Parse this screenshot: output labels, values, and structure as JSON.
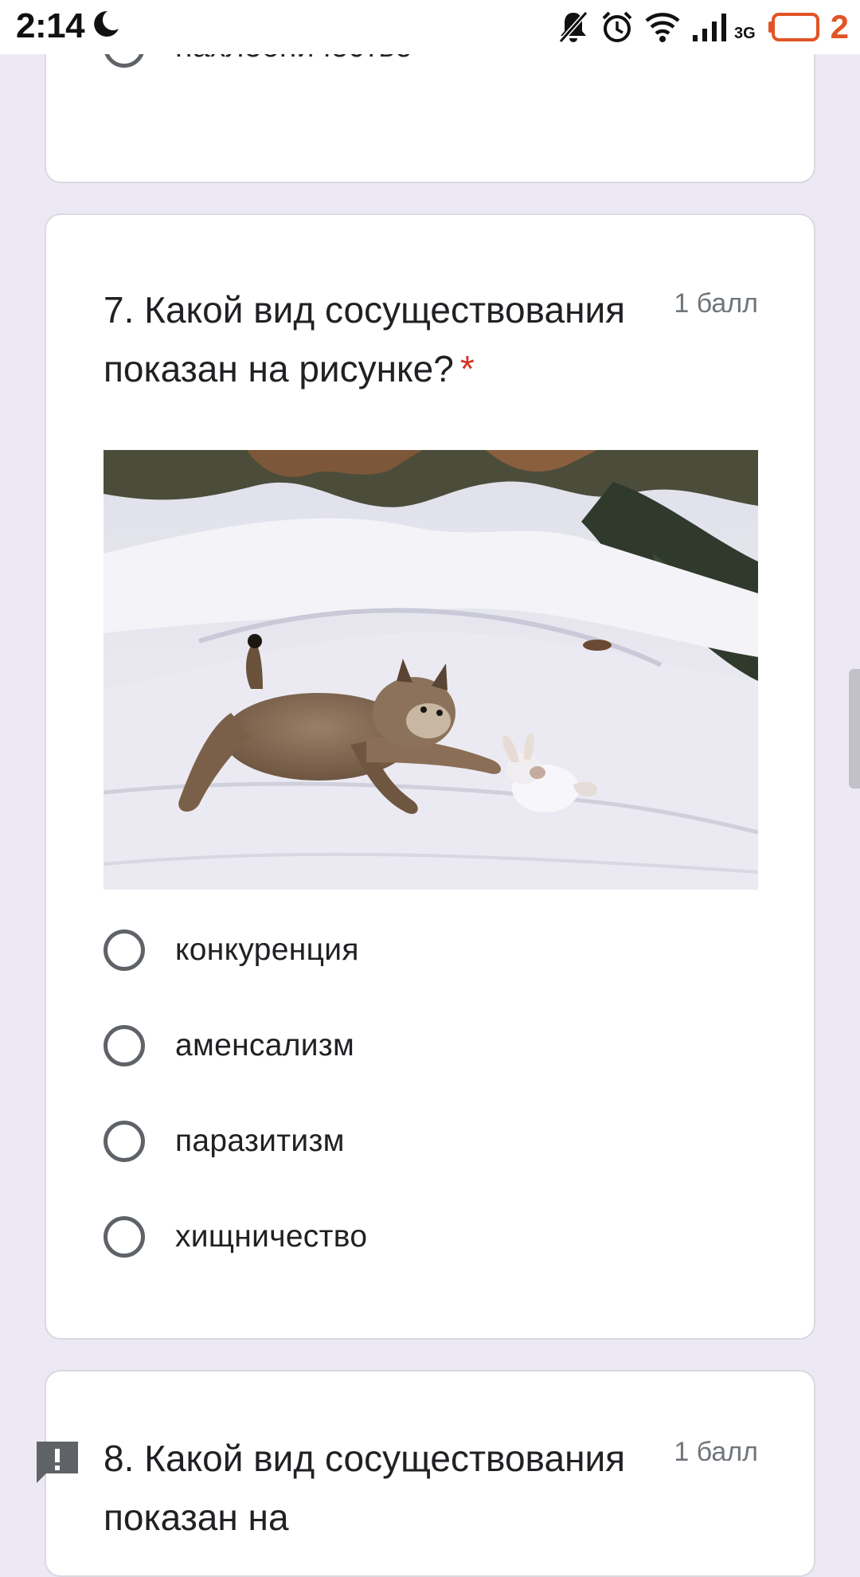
{
  "status_bar": {
    "time": "2:14",
    "network_type": "3G",
    "battery_level_text": "2",
    "icons": [
      "moon-icon",
      "bell-off-icon",
      "alarm-icon",
      "wifi-icon",
      "signal-icon",
      "battery-icon"
    ]
  },
  "previous_question": {
    "last_option": "нахлебничество"
  },
  "question_7": {
    "title": "7. Какой вид сосуществования показан на рисунке?",
    "required_mark": "*",
    "points": "1 балл",
    "options": [
      "конкуренция",
      "аменсализм",
      "паразитизм",
      "хищничество"
    ]
  },
  "question_8": {
    "title": "8. Какой вид сосуществования показан на",
    "points": "1 балл"
  },
  "colors": {
    "background": "#ece9f5",
    "card": "#ffffff",
    "required": "#d93025",
    "battery_low": "#e25426",
    "radio_border": "#5f6368"
  }
}
